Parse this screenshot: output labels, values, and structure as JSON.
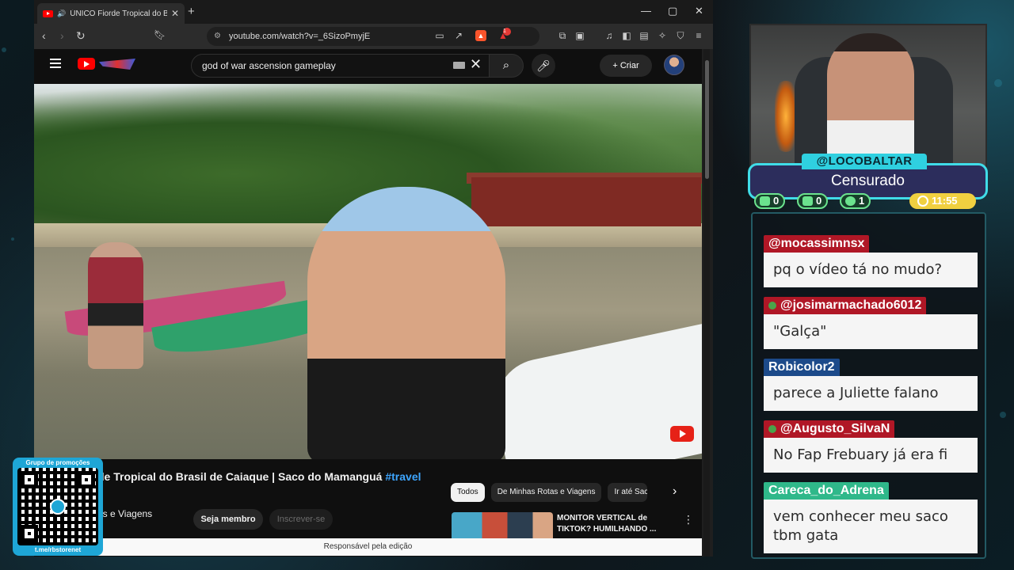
{
  "browser": {
    "tab_title": "ÚNICO Fiorde Tropical do Brasil de",
    "url": "youtube.com/watch?v=_6SizoPmyjE",
    "brave_badge": "",
    "notification_badge": "1"
  },
  "youtube": {
    "search_query": "god of war ascension gameplay",
    "create_label": "Criar",
    "video_title_visible": "de Tropical do Brasil de Caiaque | Saco do Mamanguá",
    "video_hashtag": "#travel",
    "channel_name_partial": "as e Viagens",
    "member_button": "Seja membro",
    "subscribe_button": "Inscrever-se",
    "chips": [
      "Todos",
      "De Minhas Rotas e Viagens",
      "Ir até Saco"
    ],
    "recommendation": {
      "title": "MONITOR VERTICAL de TIKTOK? HUMILHANDO ..."
    },
    "footer_text": "Responsável pela edição"
  },
  "promo": {
    "label": "Grupo de promoções",
    "link": "t.me/rbstorenet"
  },
  "streamer": {
    "handle": "@LOCOBALTAR",
    "status": "Censurado",
    "stats": [
      {
        "icon": "twitch-icon",
        "value": "0"
      },
      {
        "icon": "youtube-icon",
        "value": "0"
      },
      {
        "icon": "kick-icon",
        "value": "1"
      }
    ],
    "timer": "11:55"
  },
  "chat": {
    "messages": [
      {
        "user": "@mocassimnsx",
        "color": "red",
        "text": "pq o vídeo tá no mudo?"
      },
      {
        "user": "@josimarmachado6012",
        "color": "red",
        "text": "\"Galça\""
      },
      {
        "user": "Robicolor2",
        "color": "blue",
        "text": "parece a Juliette falano"
      },
      {
        "user": "@Augusto_SilvaN",
        "color": "red",
        "text": "No Fap Frebuary já era fi"
      },
      {
        "user": "Careca_do_Adrena",
        "color": "green",
        "text": "vem conhecer meu saco tbm gata"
      }
    ]
  },
  "colors": {
    "accent_cyan": "#40dce8",
    "status_panel": "#2c2d5c",
    "timer_yellow": "#f0d040",
    "chat_red": "#b01726",
    "chat_blue": "#1c4a8a",
    "chat_green": "#2fb88a"
  }
}
